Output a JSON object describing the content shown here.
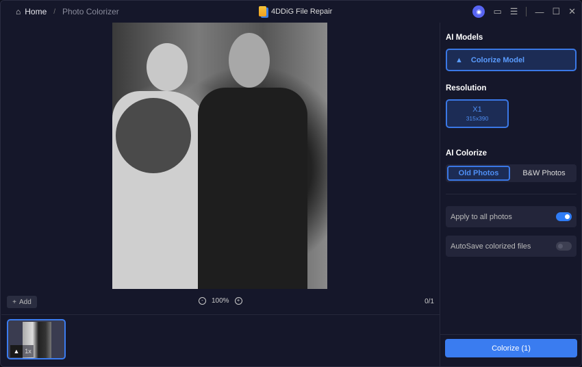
{
  "titlebar": {
    "home": "Home",
    "separator": "/",
    "current": "Photo Colorizer",
    "app_title": "4DDiG File Repair"
  },
  "canvas": {
    "add_label": "Add",
    "zoom_level": "100%",
    "page_count": "0/1",
    "thumb_scale": "1x"
  },
  "sidebar": {
    "ai_models_heading": "AI Models",
    "model_label": "Colorize Model",
    "resolution_heading": "Resolution",
    "resolution_scale": "X1",
    "resolution_size": "315x390",
    "ai_colorize_heading": "AI Colorize",
    "mode_options": [
      "Old Photos",
      "B&W Photos"
    ],
    "apply_all_label": "Apply to all photos",
    "apply_all_on": true,
    "autosave_label": "AutoSave colorized files",
    "autosave_on": false,
    "colorize_button": "Colorize (1)"
  },
  "colors": {
    "accent": "#3a7cf0",
    "background": "#15172a"
  }
}
